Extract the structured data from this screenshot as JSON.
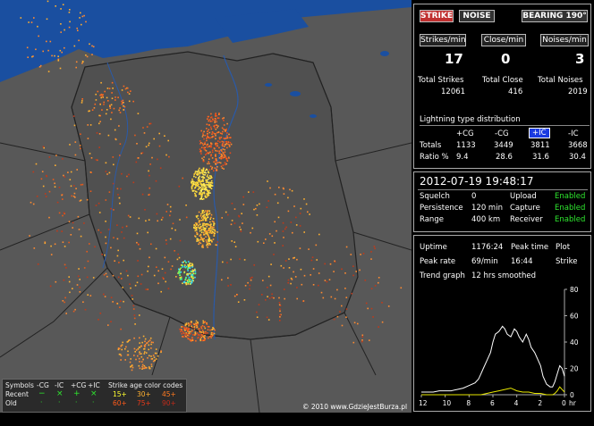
{
  "toolbar": {
    "strike_label": "STRIKE",
    "noise_label": "NOISE",
    "bearing_label": "BEARING 190°"
  },
  "rates": {
    "strikes_label": "Strikes/min",
    "close_label": "Close/min",
    "noises_label": "Noises/min",
    "strikes_value": "17",
    "close_value": "0",
    "noises_value": "3",
    "total_strikes_label": "Total Strikes",
    "total_close_label": "Total Close",
    "total_noises_label": "Total Noises",
    "total_strikes": "12061",
    "total_close": "416",
    "total_noises": "2019"
  },
  "distribution": {
    "title": "Lightning type distribution",
    "headers": [
      "+CG",
      "-CG",
      "+IC",
      "-IC"
    ],
    "totals_label": "Totals",
    "ratio_label": "Ratio %",
    "totals": [
      "1133",
      "3449",
      "3811",
      "3668"
    ],
    "ratio": [
      "9.4",
      "28.6",
      "31.6",
      "30.4"
    ]
  },
  "status": {
    "datetime": "2012-07-19 19:48:17",
    "squelch_label": "Squelch",
    "squelch_value": "0",
    "persistence_label": "Persistence",
    "persistence_value": "120 min",
    "range_label": "Range",
    "range_value": "400 km",
    "upload_label": "Upload",
    "upload_value": "Enabled",
    "capture_label": "Capture",
    "capture_value": "Enabled",
    "receiver_label": "Receiver",
    "receiver_value": "Enabled"
  },
  "stats": {
    "uptime_label": "Uptime",
    "uptime_value": "1176:24",
    "peak_time_label": "Peak time",
    "peak_time_value": "16:44",
    "peak_rate_label": "Peak rate",
    "peak_rate_value": "69/min",
    "plot_label": "Plot",
    "plot_value": "Strike",
    "trend_label": "Trend graph",
    "trend_value": "12 hrs smoothed"
  },
  "chart_data": {
    "type": "line",
    "xlabel": "hr",
    "x_ticks": [
      "12",
      "10",
      "8",
      "6",
      "4",
      "2",
      "0"
    ],
    "y_ticks": [
      "80",
      "60",
      "40",
      "20",
      "0"
    ],
    "ylim": [
      0,
      80
    ],
    "xlim": [
      12,
      0
    ],
    "series": [
      {
        "color": "#ffffff",
        "x": [
          12,
          11.5,
          11,
          10.5,
          10,
          9.5,
          9,
          8.5,
          8,
          7.5,
          7.2,
          7,
          6.8,
          6.5,
          6.2,
          6,
          5.8,
          5.5,
          5.2,
          5,
          4.8,
          4.5,
          4.2,
          4,
          3.8,
          3.5,
          3.2,
          3,
          2.8,
          2.5,
          2.2,
          2,
          1.8,
          1.5,
          1.2,
          1,
          0.8,
          0.6,
          0.4,
          0.2,
          0
        ],
        "values": [
          2,
          2,
          2,
          3,
          3,
          3,
          4,
          5,
          7,
          9,
          12,
          16,
          20,
          26,
          32,
          40,
          46,
          48,
          52,
          50,
          46,
          44,
          50,
          48,
          44,
          40,
          46,
          42,
          36,
          32,
          26,
          22,
          14,
          8,
          6,
          6,
          10,
          16,
          22,
          20,
          14
        ]
      },
      {
        "color": "#e8e800",
        "x": [
          12,
          9,
          8,
          7,
          6.5,
          6,
          5.5,
          5,
          4.5,
          4,
          3.5,
          3,
          2.5,
          2,
          1.5,
          1,
          0.8,
          0.6,
          0.4,
          0.2,
          0
        ],
        "values": [
          0,
          0,
          0,
          0,
          1,
          2,
          3,
          4,
          5,
          3,
          2,
          2,
          1,
          1,
          0,
          0,
          1,
          3,
          6,
          4,
          2
        ]
      }
    ]
  },
  "legend": {
    "symbols_label": "Symbols",
    "cg_minus": "-CG",
    "ic_minus": "-IC",
    "cg_plus": "+CG",
    "ic_plus": "+IC",
    "age_label": "Strike age color codes",
    "recent_label": "Recent",
    "old_label": "Old",
    "recent_ages": [
      "15+",
      "30+",
      "45+"
    ],
    "old_ages": [
      "60+",
      "75+",
      "90+"
    ]
  },
  "map": {
    "copyright": "© 2010 www.GdzieJestBurza.pl"
  }
}
